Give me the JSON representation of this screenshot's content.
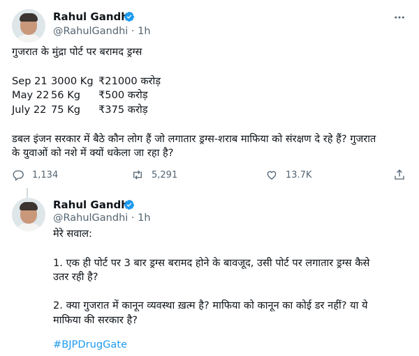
{
  "tweet1": {
    "name": "Rahul Gandhi",
    "handle": "@RahulGandhi",
    "time": "1h",
    "title": "गुजरात के मुंद्रा पोर्ट पर बरामद ड्रग्स",
    "rows": [
      {
        "date": "Sep 21",
        "qty": "3000 Kg",
        "value": "₹21000 करोड़"
      },
      {
        "date": "May 22",
        "qty": "56 Kg",
        "value": "₹500 करोड़"
      },
      {
        "date": "July 22",
        "qty": "75 Kg",
        "value": "₹375 करोड़"
      }
    ],
    "body_line1": "डबल इंजन सरकार में बैठे कौन लोग हैं जो लगातार ड्रग्स-शराब माफिया को संरक्षण दे रहे हैं? गुजरात",
    "body_line2": "के युवाओं को नशे में क्यों धकेला जा रहा है?",
    "replies": "1,134",
    "retweets": "5,291",
    "likes": "13.7K"
  },
  "tweet2": {
    "name": "Rahul Gandhi",
    "handle": "@RahulGandhi",
    "time": "1h",
    "intro": "मेरे सवाल:",
    "q1_line1": "1. एक ही पोर्ट पर 3 बार ड्रग्स बरामद होने के बावजूद, उसी पोर्ट पर लगातार ड्रग्स कैसे",
    "q1_line2": "उतर रही है?",
    "q2_line1": "2. क्या गुजरात में कानून व्यवस्था ख़त्म है? माफिया को कानून का कोई डर नहीं? या ये",
    "q2_line2": "माफिया की सरकार है?",
    "hashtag": "#BJPDrugGate"
  },
  "colors": {
    "verified": "#1d9bf0",
    "secondary": "#536471",
    "link": "#1d9bf0",
    "thread_line": "#cfd9de"
  },
  "icons": [
    "reply-icon",
    "retweet-icon",
    "like-icon",
    "share-icon",
    "more-icon",
    "verified-badge-icon"
  ]
}
